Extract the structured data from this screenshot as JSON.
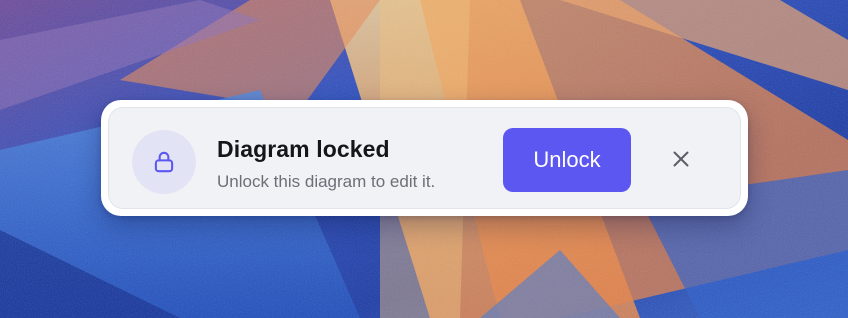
{
  "notification": {
    "title": "Diagram locked",
    "message": "Unlock this diagram to edit it.",
    "icon": "lock-icon",
    "unlock_label": "Unlock",
    "close_icon": "close-icon"
  },
  "colors": {
    "accent": "#5b57f0",
    "icon_badge": "#e3e3f6",
    "card_background": "#f1f2f5",
    "title_text": "#15161a",
    "message_text": "#6b6f78"
  }
}
